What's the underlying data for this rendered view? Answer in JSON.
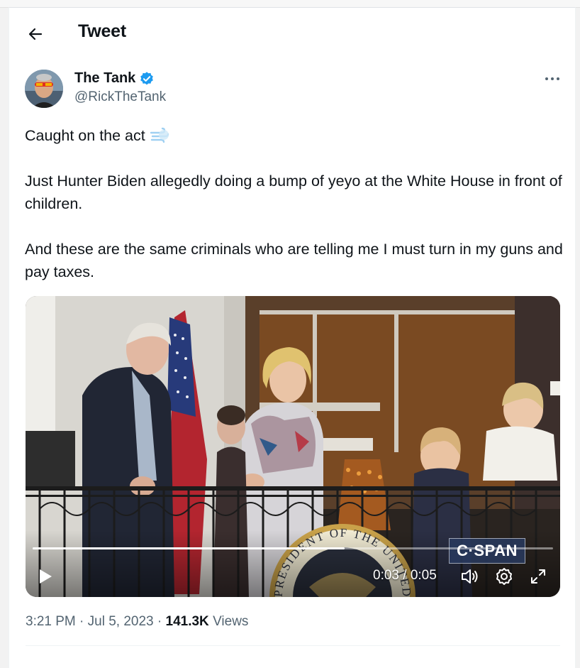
{
  "header": {
    "title": "Tweet"
  },
  "author": {
    "display_name": "The Tank",
    "handle": "@RickTheTank"
  },
  "tweet": {
    "line1": "Caught on the act",
    "line1_emoji": "dash-symbol-emoji",
    "paragraph2": "Just Hunter Biden allegedly doing a bump of yeyo at the White House in front of children.",
    "paragraph3": "And these are the same criminals who are telling me I must turn in my guns and pay taxes."
  },
  "video": {
    "time": "0:03 / 0:05",
    "progress": 0.6,
    "watermark": "C·SPAN",
    "seal_text": "PRESIDENT OF THE UNITED"
  },
  "meta": {
    "time": "3:21 PM",
    "date": "Jul 5, 2023",
    "views_count": "141.3K",
    "views_label": "Views",
    "separator": "·"
  },
  "colors": {
    "accent": "#1d9bf0",
    "secondary_text": "#536471",
    "text": "#0f1419"
  },
  "icons": [
    "back-arrow-icon",
    "verified-badge-icon",
    "more-options-icon",
    "play-icon",
    "volume-icon",
    "settings-icon",
    "fullscreen-icon"
  ]
}
